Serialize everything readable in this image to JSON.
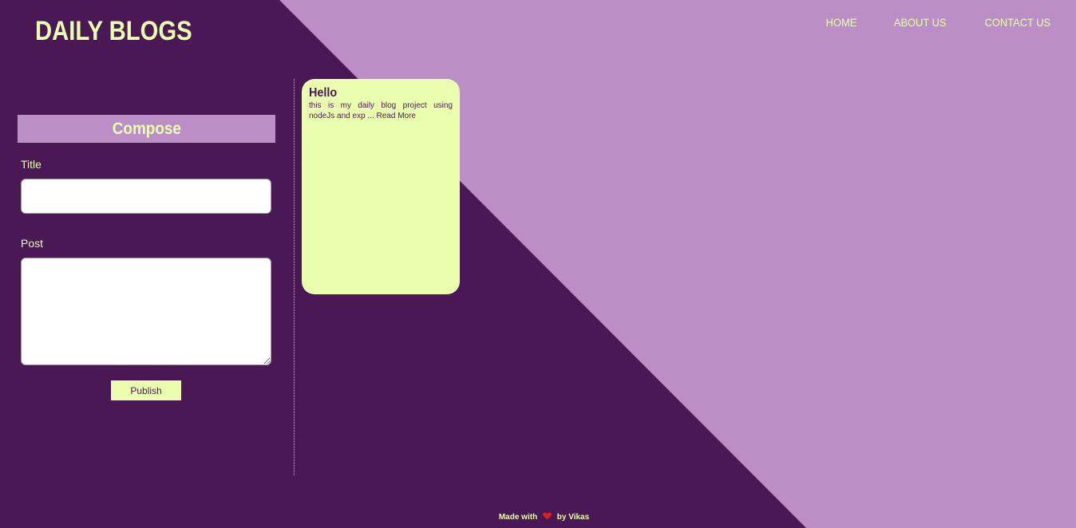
{
  "header": {
    "brand": "DAILY BLOGS",
    "nav": [
      {
        "label": "HOME"
      },
      {
        "label": "ABOUT US"
      },
      {
        "label": "CONTACT US"
      }
    ]
  },
  "compose": {
    "heading": "Compose",
    "title_label": "Title",
    "title_value": "",
    "post_label": "Post",
    "post_value": "",
    "publish_label": "Publish"
  },
  "posts": [
    {
      "title": "Hello",
      "excerpt": "this is my daily blog project using nodeJs and exp ...",
      "read_more": "Read More"
    }
  ],
  "footer": {
    "made_with": "Made with",
    "by": "by Vikas",
    "icon": "heart-icon"
  },
  "colors": {
    "dark_purple": "#4a1955",
    "light_purple": "#bb8fc5",
    "accent_lime": "#e9ffaf",
    "heart_red": "#e02020"
  }
}
